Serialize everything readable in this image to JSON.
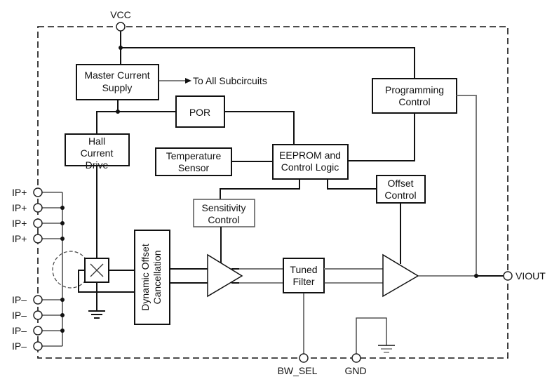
{
  "diagram": {
    "pins": {
      "vcc": "VCC",
      "ip_plus": [
        "IP+",
        "IP+",
        "IP+",
        "IP+"
      ],
      "ip_minus": [
        "IP–",
        "IP–",
        "IP–",
        "IP–"
      ],
      "viout": "VIOUT",
      "bw_sel": "BW_SEL",
      "gnd": "GND"
    },
    "blocks": {
      "master_current_supply": [
        "Master Current",
        "Supply"
      ],
      "por": [
        "POR"
      ],
      "hall_current_drive": [
        "Hall",
        "Current",
        "Drive"
      ],
      "temperature_sensor": [
        "Temperature",
        "Sensor"
      ],
      "eeprom_control_logic": [
        "EEPROM and",
        "Control Logic"
      ],
      "programming_control": [
        "Programming",
        "Control"
      ],
      "offset_control": [
        "Offset",
        "Control"
      ],
      "sensitivity_control": [
        "Sensitivity",
        "Control"
      ],
      "dynamic_offset_cancellation": [
        "Dynamic Offset",
        "Cancellation"
      ],
      "tuned_filter": [
        "Tuned",
        "Filter"
      ]
    },
    "annotations": {
      "to_all_subcircuits": "To All Subcircuits"
    }
  }
}
